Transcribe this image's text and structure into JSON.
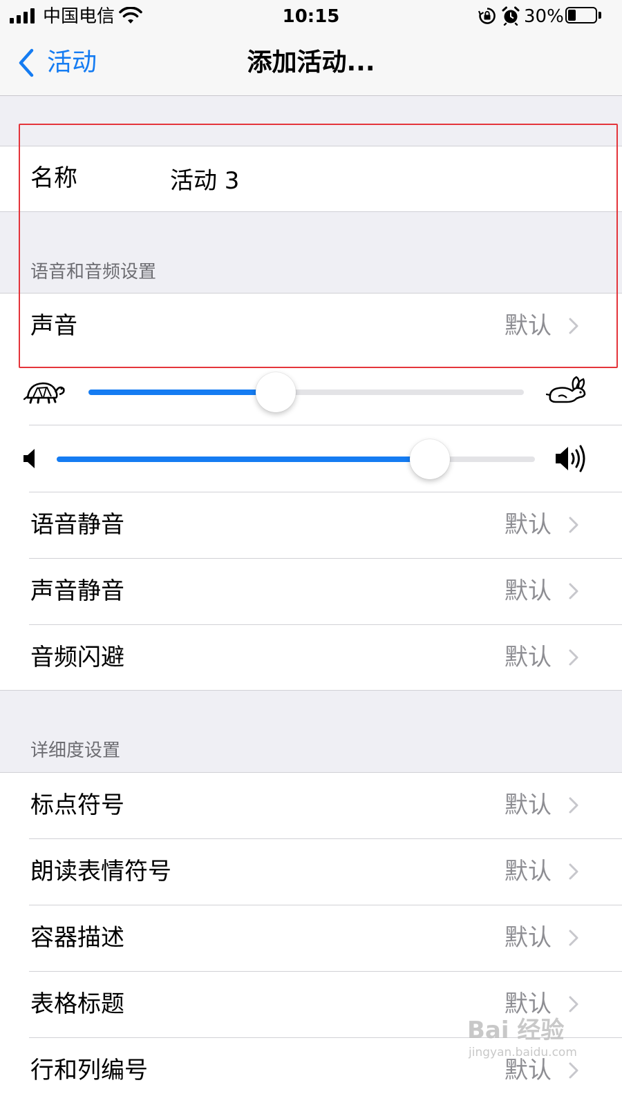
{
  "status_bar": {
    "carrier": "中国电信",
    "time": "10:15",
    "battery_percent": "30%",
    "battery_level": 0.3,
    "icons": [
      "signal-icon",
      "wifi-icon",
      "orientation-lock-icon",
      "alarm-icon",
      "battery-icon"
    ]
  },
  "nav": {
    "back_label": "活动",
    "title": "添加活动..."
  },
  "name_row": {
    "label": "名称",
    "value": "活动 3"
  },
  "voice_section": {
    "header": "语音和音频设置",
    "sound": {
      "label": "声音",
      "value": "默认"
    },
    "speaking_rate": {
      "level": 0.43,
      "min_icon": "turtle-icon",
      "max_icon": "rabbit-icon"
    },
    "volume": {
      "level": 0.78,
      "min_icon": "speaker-low-icon",
      "max_icon": "speaker-high-icon"
    },
    "rows": [
      {
        "label": "语音静音",
        "value": "默认"
      },
      {
        "label": "声音静音",
        "value": "默认"
      },
      {
        "label": "音频闪避",
        "value": "默认"
      }
    ]
  },
  "verbosity_section": {
    "header": "详细度设置",
    "rows": [
      {
        "label": "标点符号",
        "value": "默认"
      },
      {
        "label": "朗读表情符号",
        "value": "默认"
      },
      {
        "label": "容器描述",
        "value": "默认"
      },
      {
        "label": "表格标题",
        "value": "默认"
      },
      {
        "label": "行和列编号",
        "value": "默认"
      }
    ]
  },
  "watermark": {
    "text": "Bai 经验",
    "subtext": "jingyan.baidu.com"
  },
  "colors": {
    "accent": "#157cf2",
    "highlight_box": "#e4343a",
    "secondary_text": "#8e8e93",
    "background": "#efeff4"
  }
}
